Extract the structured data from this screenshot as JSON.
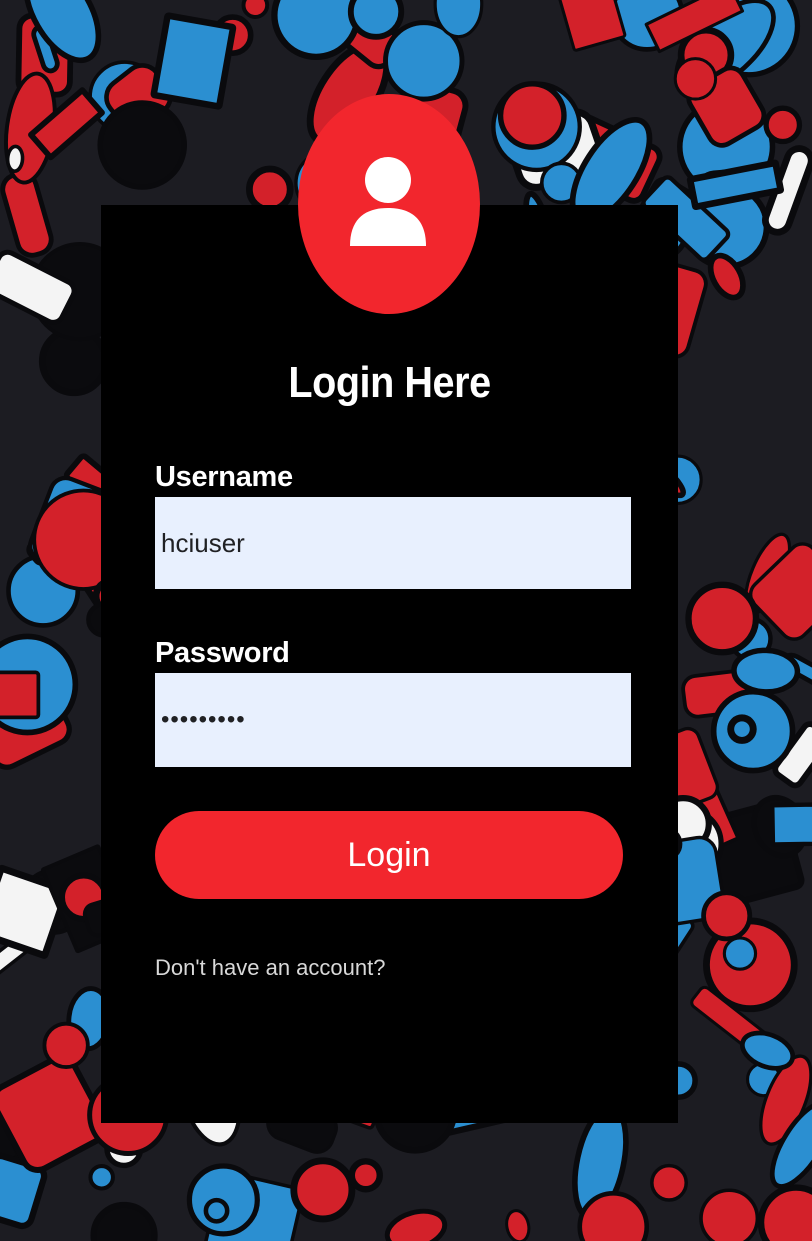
{
  "login_form": {
    "title": "Login Here",
    "username": {
      "label": "Username",
      "value": "hciuser"
    },
    "password": {
      "label": "Password",
      "value": "passwords"
    },
    "submit_label": "Login",
    "signup_link": "Don't have an account?"
  },
  "icons": {
    "avatar": "user-icon"
  },
  "colors": {
    "accent": "#f2262d",
    "card": "#000000",
    "input_background": "#e8f0fe",
    "text": "#ffffff",
    "bg_red": "#d3212a",
    "bg_blue": "#2b8fd1"
  }
}
